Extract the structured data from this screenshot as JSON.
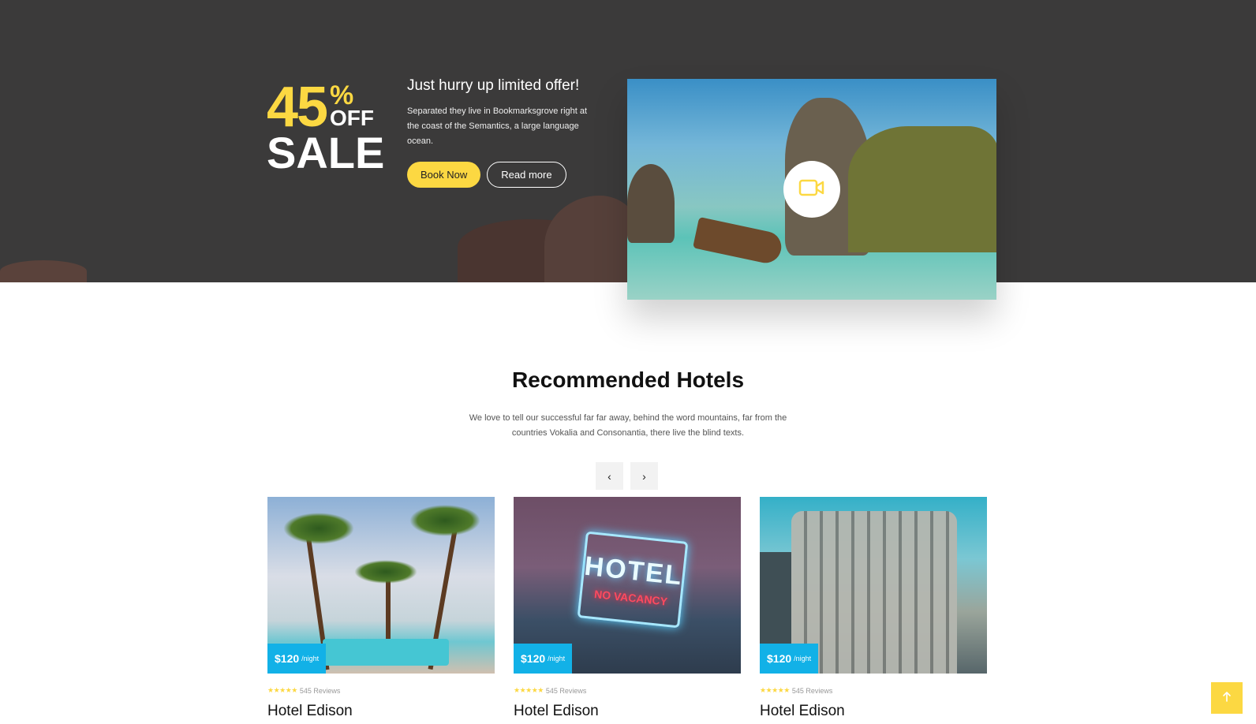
{
  "promo": {
    "discount_number": "45",
    "percent_sign": "%",
    "off_label": "OFF",
    "sale_label": "SALE",
    "heading": "Just hurry up limited offer!",
    "description": "Separated they live in Bookmarksgrove right at the coast of the Semantics, a large language ocean.",
    "book_now_label": "Book Now",
    "read_more_label": "Read more",
    "video_icon": "video-camera-icon"
  },
  "recommended": {
    "title": "Recommended Hotels",
    "description": "We love to tell our successful far far away, behind the word mountains, far from the countries Vokalia and Consonantia, there live the blind texts.",
    "prev_label": "‹",
    "next_label": "›",
    "hotels": [
      {
        "price": "$120",
        "unit": "/night",
        "stars": "★★★★★",
        "reviews": "545 Reviews",
        "name": "Hotel Edison"
      },
      {
        "price": "$120",
        "unit": "/night",
        "stars": "★★★★★",
        "reviews": "545 Reviews",
        "name": "Hotel Edison"
      },
      {
        "price": "$120",
        "unit": "/night",
        "stars": "★★★★★",
        "reviews": "545 Reviews",
        "name": "Hotel Edison"
      }
    ],
    "hotel1_sign": {
      "line1": "HOTEL",
      "line2": "NO VACANCY"
    }
  },
  "scroll_top_icon": "arrow-up-icon",
  "colors": {
    "accent_yellow": "#fcd842",
    "price_blue": "#12b1e7",
    "promo_bg": "#3b3a3a"
  }
}
